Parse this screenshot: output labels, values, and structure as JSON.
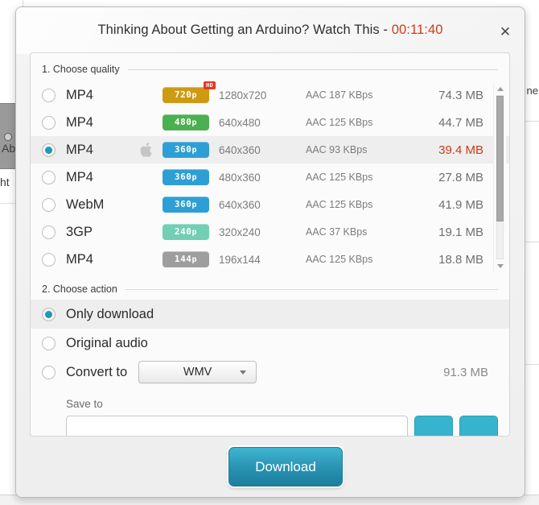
{
  "background": {
    "left_text_a": "Ab",
    "left_text_b": "ht",
    "right_text": "ne"
  },
  "modal": {
    "title_text": "Thinking About Getting an Arduino? Watch This - ",
    "duration": "00:11:40",
    "close_label": "✕",
    "accent_color": "#1b9bb8",
    "duration_color": "#d13b14"
  },
  "quality_section": {
    "heading": "1. Choose quality",
    "rows": [
      {
        "format": "MP4",
        "apple": false,
        "badge": "720",
        "badge_suffix": "p",
        "badge_color": "#cf9a13",
        "hd": true,
        "hd_label": "HD",
        "resolution": "1280x720",
        "audio": "AAC 187  KBps",
        "size": "74.3 MB",
        "selected": false
      },
      {
        "format": "MP4",
        "apple": false,
        "badge": "480",
        "badge_suffix": "p",
        "badge_color": "#4caf50",
        "hd": false,
        "hd_label": "",
        "resolution": "640x480",
        "audio": "AAC 125  KBps",
        "size": "44.7 MB",
        "selected": false
      },
      {
        "format": "MP4",
        "apple": true,
        "badge": "360",
        "badge_suffix": "p",
        "badge_color": "#2e9fd4",
        "hd": false,
        "hd_label": "",
        "resolution": "640x360",
        "audio": "AAC 93  KBps",
        "size": "39.4 MB",
        "selected": true
      },
      {
        "format": "MP4",
        "apple": false,
        "badge": "360",
        "badge_suffix": "p",
        "badge_color": "#2e9fd4",
        "hd": false,
        "hd_label": "",
        "resolution": "480x360",
        "audio": "AAC 125  KBps",
        "size": "27.8 MB",
        "selected": false
      },
      {
        "format": "WebM",
        "apple": false,
        "badge": "360",
        "badge_suffix": "p",
        "badge_color": "#2e9fd4",
        "hd": false,
        "hd_label": "",
        "resolution": "640x360",
        "audio": "AAC 125  KBps",
        "size": "41.9 MB",
        "selected": false
      },
      {
        "format": "3GP",
        "apple": false,
        "badge": "240",
        "badge_suffix": "p",
        "badge_color": "#72cfb4",
        "hd": false,
        "hd_label": "",
        "resolution": "320x240",
        "audio": "AAC 37  KBps",
        "size": "19.1 MB",
        "selected": false
      },
      {
        "format": "MP4",
        "apple": false,
        "badge": "144",
        "badge_suffix": "p",
        "badge_color": "#9e9e9e",
        "hd": false,
        "hd_label": "",
        "resolution": "196x144",
        "audio": "AAC 125  KBps",
        "size": "18.8 MB",
        "selected": false
      }
    ]
  },
  "action_section": {
    "heading": "2. Choose action",
    "options": [
      {
        "label": "Only download",
        "selected": true
      },
      {
        "label": "Original audio",
        "selected": false
      },
      {
        "label": "Convert to",
        "selected": false
      }
    ],
    "convert_format": "WMV",
    "convert_size": "91.3 MB",
    "save_to_label": "Save to",
    "save_to_value": ""
  },
  "footer": {
    "download_label": "Download"
  }
}
